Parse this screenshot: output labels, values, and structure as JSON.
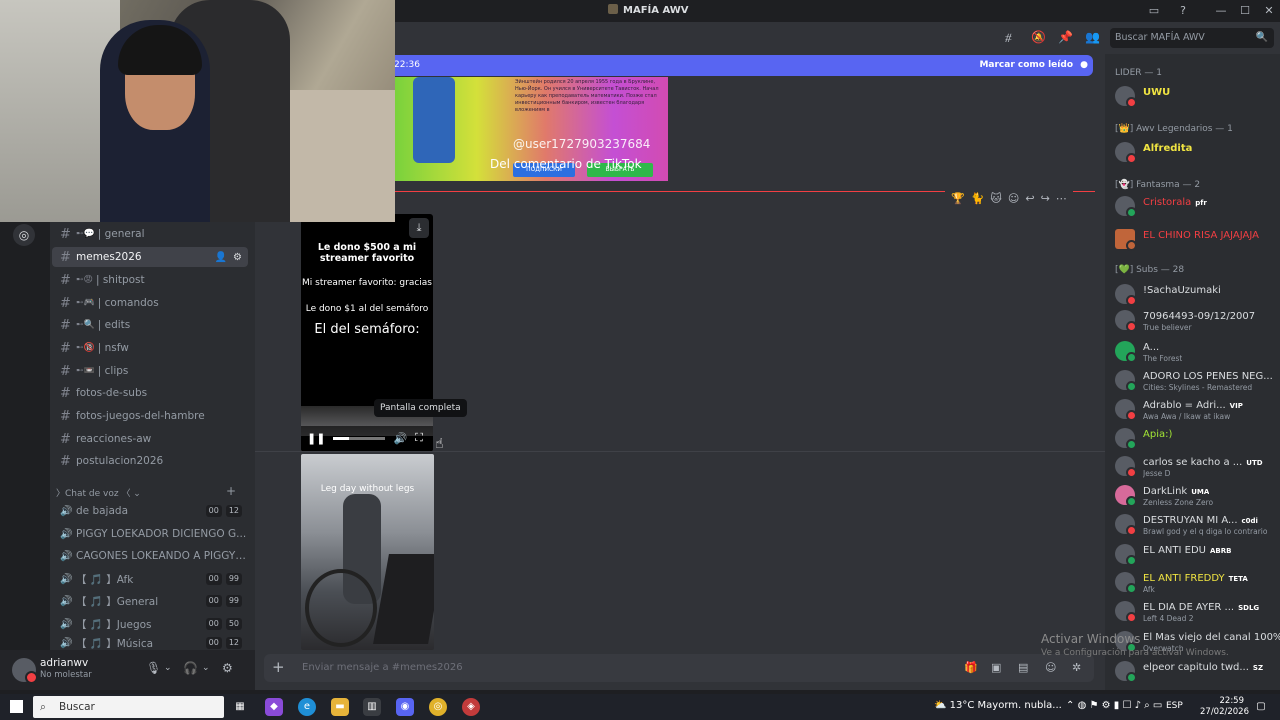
{
  "window": {
    "title": "MAFÍA AWV"
  },
  "header": {
    "search_placeholder": "Buscar MAFÍA AWV"
  },
  "new_messages_bar": {
    "time": "22:36",
    "mark_read": "Marcar como leído"
  },
  "image_meme": {
    "username": "@user1727903237684",
    "comment": "Del comentario de TikTok",
    "btn1": "ПОДПИСКИ",
    "btn2": "ВЫБРАТЬ",
    "russian_text": "Эйнштейн родился 20 апреля 1955 года в Бруклине, Нью-Йорк. Он учился в Университете Тависток. Начал карьеру как преподаватель математики. Позже стал инвестиционным банкиром, известен благодаря вложениям в"
  },
  "video": {
    "line1": "Le dono $500 a mi streamer favorito",
    "line2": "Mi streamer favorito: gracias",
    "line3": "Le dono $1 al del semáforo",
    "line4": "El del semáforo:",
    "tooltip": "Pantalla completa"
  },
  "image_gym": {
    "caption": "Leg day without legs"
  },
  "channels": [
    {
      "name": "| general",
      "prefix": "➸💬"
    },
    {
      "name": "memes2026",
      "selected": true
    },
    {
      "name": "| shitpost",
      "prefix": "➸😡"
    },
    {
      "name": "| comandos",
      "prefix": "➸🎮"
    },
    {
      "name": "| edits",
      "prefix": "➸🔍"
    },
    {
      "name": "| nsfw",
      "prefix": "➸🔞"
    },
    {
      "name": "| clips",
      "prefix": "➸📼"
    },
    {
      "name": "fotos-de-subs"
    },
    {
      "name": "fotos-juegos-del-hambre"
    },
    {
      "name": "reacciones-aw"
    },
    {
      "name": "postulacion2026"
    }
  ],
  "voice_header": "Chat de voz",
  "voice_channels": [
    {
      "name": "de bajada",
      "c1": "00",
      "c2": "12"
    },
    {
      "name": "PIGGY LOEKADOR DICIENGO G..."
    },
    {
      "name": "CAGONES LOKEANDO A PIGGY ..."
    },
    {
      "name": "【 🎵 】Afk",
      "c1": "00",
      "c2": "99"
    },
    {
      "name": "【 🎵 】General",
      "c1": "00",
      "c2": "99"
    },
    {
      "name": "【 🎵 】Juegos",
      "c1": "00",
      "c2": "50"
    },
    {
      "name": "【 🎵 】Música",
      "c1": "00",
      "c2": "12"
    }
  ],
  "user": {
    "name": "adrianwv",
    "status": "No molestar"
  },
  "composer": {
    "placeholder": "Enviar mensaje a #memes2026"
  },
  "members": {
    "groups": [
      {
        "label": "LIDER — 1"
      },
      {
        "label": "[👑] Awv Legendarios — 1"
      },
      {
        "label": "[👻] Fantasma — 2"
      },
      {
        "label": "[💚] Subs — 28"
      }
    ],
    "list": [
      {
        "name": "UWU",
        "color": "#f0e442"
      },
      {
        "name": "Alfredita",
        "color": "#f0e442"
      },
      {
        "name": "Cristorala",
        "color": "#f23f43",
        "tag": "pfr"
      },
      {
        "name": "EL CHINO RISA JAJAJAJA",
        "color": "#f23f43"
      },
      {
        "name": "!SachaUzumaki"
      },
      {
        "name": "70964493-09/12/2007",
        "sub": "True believer"
      },
      {
        "name": "A...",
        "sub": "The Forest"
      },
      {
        "name": "ADORO LOS PENES NEG...",
        "sub": "Cities: Skylines - Remastered"
      },
      {
        "name": "Adrablo = Adri...",
        "tag": "VIP",
        "sub": "Awa Awa / Ikaw at ikaw"
      },
      {
        "name": "Apia:)",
        "color": "#a3e635"
      },
      {
        "name": "carlos se kacho a ...",
        "tag": "UTD",
        "sub": "Jesse D"
      },
      {
        "name": "DarkLink",
        "tag": "UMA",
        "sub": "Zenless Zone Zero"
      },
      {
        "name": "DESTRUYAN MI A...",
        "tag": "c0di",
        "sub": "Brawl god y el q diga lo contrario"
      },
      {
        "name": "EL ANTI EDU",
        "tag": "ABRB"
      },
      {
        "name": "EL ANTI FREDDY",
        "color": "#f0e442",
        "tag": "TETA",
        "sub": "Afk"
      },
      {
        "name": "EL DIA DE AYER ...",
        "tag": "SDLG",
        "sub": "Left 4 Dead 2"
      },
      {
        "name": "El Mas viejo del canal 100%",
        "sub": "Overwatch"
      },
      {
        "name": "elpeor capitulo twd...",
        "tag": "SZ"
      }
    ]
  },
  "watermark": {
    "line1": "Activar Windows",
    "line2": "Ve a Configuración para activar Windows."
  },
  "taskbar": {
    "search": "Buscar",
    "weather": "13°C  Mayorm. nubla...",
    "lang": "ESP",
    "time": "22:59",
    "date": "27/02/2026"
  }
}
